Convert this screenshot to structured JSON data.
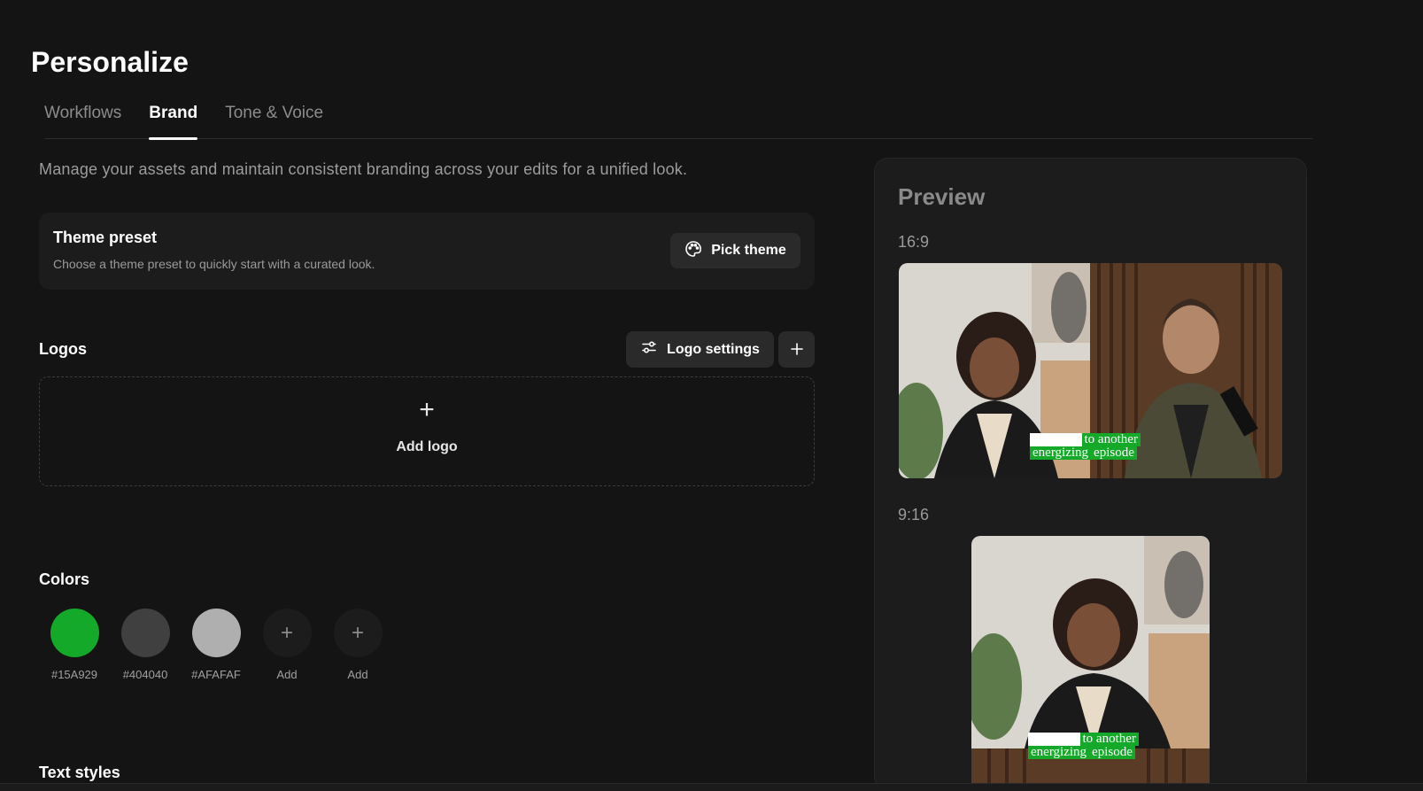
{
  "page": {
    "title": "Personalize"
  },
  "tabs": [
    {
      "label": "Workflows",
      "active": false
    },
    {
      "label": "Brand",
      "active": true
    },
    {
      "label": "Tone & Voice",
      "active": false
    }
  ],
  "subtitle": "Manage your assets and maintain consistent branding across your edits for a unified look.",
  "theme_preset": {
    "title": "Theme preset",
    "description": "Choose a theme preset to quickly start with a curated look.",
    "button_label": "Pick theme",
    "button_icon": "palette-icon"
  },
  "logos": {
    "title": "Logos",
    "settings_label": "Logo settings",
    "settings_icon": "sliders-icon",
    "add_icon": "plus-icon",
    "dropzone_icon": "+",
    "dropzone_label": "Add logo"
  },
  "colors": {
    "title": "Colors",
    "swatches": [
      {
        "hex": "#15A929",
        "label": "#15A929"
      },
      {
        "hex": "#404040",
        "label": "#404040"
      },
      {
        "hex": "#AFAFAF",
        "label": "#AFAFAF"
      },
      {
        "hex": "#1c1c1c",
        "label": "Add",
        "icon": "+"
      },
      {
        "hex": "#1c1c1c",
        "label": "Add",
        "icon": "+"
      }
    ]
  },
  "text_styles": {
    "title": "Text styles"
  },
  "preview": {
    "title": "Preview",
    "landscape": {
      "ratio": "16:9",
      "caption_line1": "to another",
      "caption_line2a": "energizing",
      "caption_line2b": "episode"
    },
    "portrait": {
      "ratio": "9:16",
      "caption_line1": "to another",
      "caption_line2a": "energizing",
      "caption_line2b": "episode"
    }
  }
}
